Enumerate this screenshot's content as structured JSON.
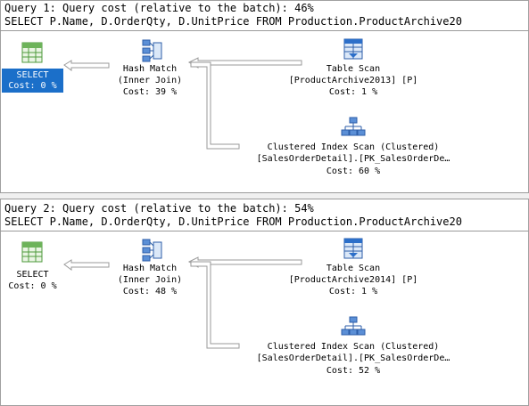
{
  "queries": [
    {
      "header": "Query 1: Query cost (relative to the batch): 46%",
      "sql": "SELECT P.Name, D.OrderQty, D.UnitPrice FROM Production.ProductArchive20",
      "select": {
        "label": "SELECT",
        "cost": "Cost: 0 %",
        "selected": true
      },
      "hash": {
        "label": "Hash Match",
        "sub": "(Inner Join)",
        "cost": "Cost: 39 %"
      },
      "scan": {
        "label": "Table Scan",
        "sub": "[ProductArchive2013] [P]",
        "cost": "Cost: 1 %"
      },
      "cix": {
        "label": "Clustered Index Scan (Clustered)",
        "sub": "[SalesOrderDetail].[PK_SalesOrderDe…",
        "cost": "Cost: 60 %"
      }
    },
    {
      "header": "Query 2: Query cost (relative to the batch): 54%",
      "sql": "SELECT P.Name, D.OrderQty, D.UnitPrice FROM Production.ProductArchive20",
      "select": {
        "label": "SELECT",
        "cost": "Cost: 0 %",
        "selected": false
      },
      "hash": {
        "label": "Hash Match",
        "sub": "(Inner Join)",
        "cost": "Cost: 48 %"
      },
      "scan": {
        "label": "Table Scan",
        "sub": "[ProductArchive2014] [P]",
        "cost": "Cost: 1 %"
      },
      "cix": {
        "label": "Clustered Index Scan (Clustered)",
        "sub": "[SalesOrderDetail].[PK_SalesOrderDe…",
        "cost": "Cost: 52 %"
      }
    }
  ],
  "colors": {
    "selection": "#1b6fc9",
    "arrow": "#9a9a9a"
  },
  "icons": [
    "select-icon",
    "hash-match-icon",
    "table-scan-icon",
    "clustered-index-scan-icon"
  ]
}
